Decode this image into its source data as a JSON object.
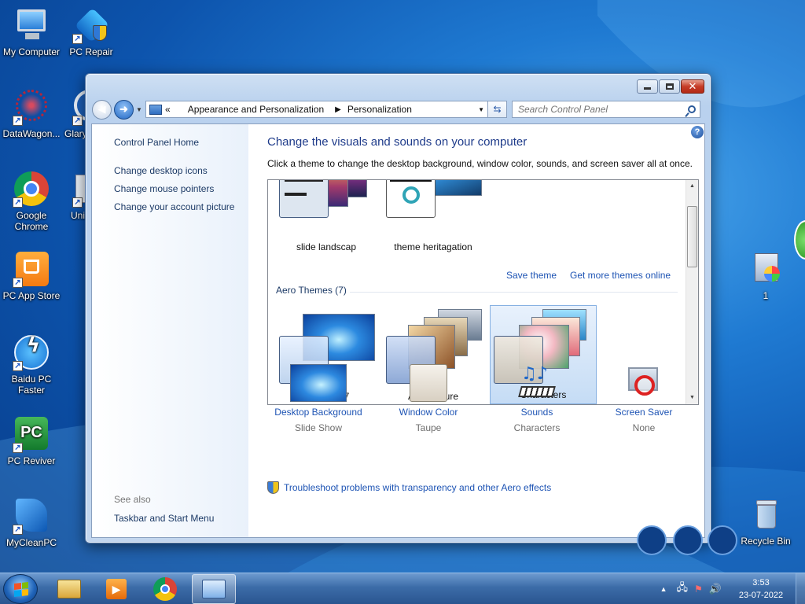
{
  "desktop": {
    "icons": [
      {
        "label": "My Computer"
      },
      {
        "label": "PC Repair"
      },
      {
        "label": "DataWagon..."
      },
      {
        "label": "Glary"
      },
      {
        "label": "Google Chrome"
      },
      {
        "label": "Uni"
      },
      {
        "label": "PC App Store"
      },
      {
        "label": "Baidu PC Faster"
      },
      {
        "label": "PC Reviver"
      },
      {
        "label": "MyCleanPC"
      },
      {
        "label": "1"
      },
      {
        "label": "Recycle Bin"
      }
    ]
  },
  "window": {
    "address": {
      "overflow": "«",
      "crumbs": [
        "Appearance and Personalization",
        "Personalization"
      ]
    },
    "search": {
      "placeholder": "Search Control Panel"
    },
    "sidebar": {
      "home": "Control Panel Home",
      "links": [
        "Change desktop icons",
        "Change mouse pointers",
        "Change your account picture"
      ],
      "see_also": "See also",
      "see_also_links": [
        "Taskbar and Start Menu"
      ]
    },
    "main": {
      "title": "Change the visuals and sounds on your computer",
      "description": "Click a theme to change the desktop background, window color, sounds, and screen saver all at once.",
      "my_themes": [
        "slide landscap",
        "theme heritagation"
      ],
      "save_theme": "Save theme",
      "get_more": "Get more themes online",
      "aero_group": "Aero Themes (7)",
      "aero_themes": [
        "Windows 7",
        "Architecture",
        "Characters"
      ],
      "selected_theme": "Characters",
      "settings": [
        {
          "title": "Desktop Background",
          "value": "Slide Show",
          "icon": "desktop-background-icon"
        },
        {
          "title": "Window Color",
          "value": "Taupe",
          "icon": "window-color-icon"
        },
        {
          "title": "Sounds",
          "value": "Characters",
          "icon": "sounds-icon"
        },
        {
          "title": "Screen Saver",
          "value": "None",
          "icon": "screen-saver-icon"
        }
      ],
      "troubleshoot": "Troubleshoot problems with transparency and other Aero effects"
    }
  },
  "taskbar": {
    "pinned": [
      "file-explorer-icon",
      "media-player-icon",
      "chrome-icon",
      "control-panel-icon"
    ],
    "active": "control-panel-icon",
    "clock": {
      "time": "3:53",
      "date": "23-07-2022"
    }
  },
  "colors": {
    "link": "#1e54b4",
    "title": "#1e3b8a",
    "selection": "#c5dcf5"
  }
}
